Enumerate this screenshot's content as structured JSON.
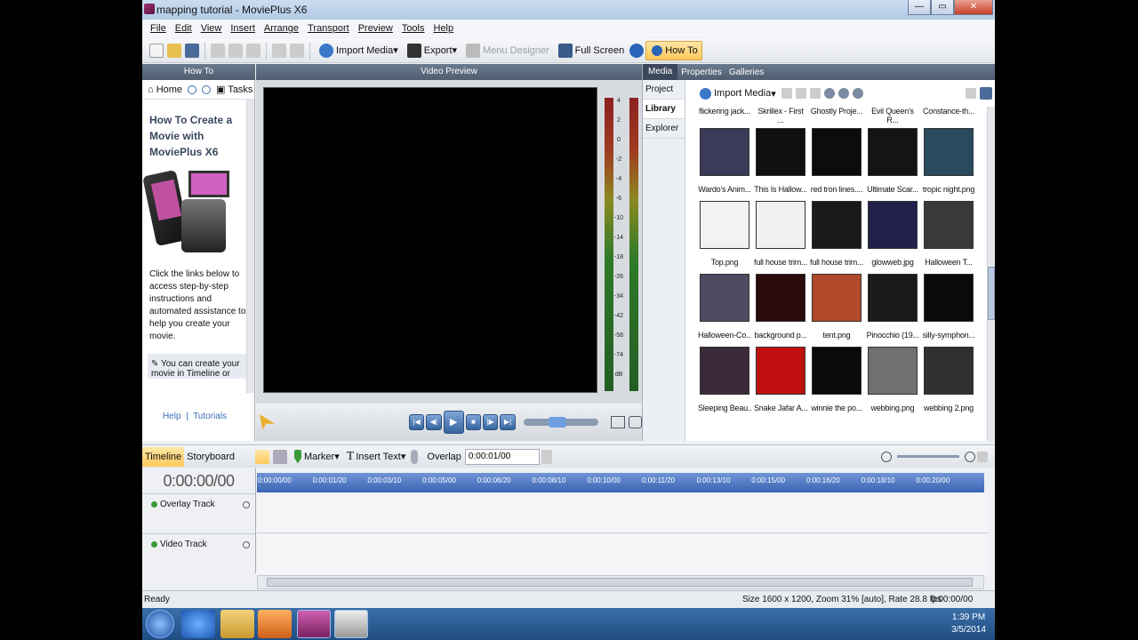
{
  "window": {
    "title": "mapping tutorial - MoviePlus X6"
  },
  "menu": [
    "File",
    "Edit",
    "View",
    "Insert",
    "Arrange",
    "Transport",
    "Preview",
    "Tools",
    "Help"
  ],
  "toolbar": {
    "import_media": "Import Media",
    "export": "Export",
    "menu_designer": "Menu Designer",
    "full_screen": "Full Screen",
    "how_to": "How To"
  },
  "howto": {
    "header": "How To",
    "home": "Home",
    "tasks": "Tasks",
    "heading": "How To Create a Movie with MoviePlus X6",
    "body": "Click the links below to access step-by-step instructions and automated assistance to help you create your movie.",
    "tip": "You can create your movie in Timeline or",
    "help": "Help",
    "tutorials": "Tutorials"
  },
  "preview": {
    "header": "Video Preview"
  },
  "meter_labels": [
    "4",
    "2",
    "0",
    "-2",
    "-4",
    "-6",
    "-10",
    "-14",
    "-18",
    "-26",
    "-34",
    "-42",
    "-58",
    "-74",
    "dB"
  ],
  "media": {
    "tabs": [
      "Media",
      "Properties",
      "Galleries"
    ],
    "side": [
      "Project",
      "Library",
      "Explorer"
    ],
    "import": "Import Media",
    "top_captions": [
      "flickering jack...",
      "Skrillex - First ...",
      "Ghostly Proje...",
      "Evil Queen's R...",
      "Constance-th..."
    ],
    "items": [
      {
        "caption": "Wardo's Anim...",
        "color": "#3a3a5a"
      },
      {
        "caption": "This Is Hallow...",
        "color": "#101010"
      },
      {
        "caption": "red tron lines....",
        "color": "#0c0c0c"
      },
      {
        "caption": "Ultimate Scar...",
        "color": "#141414"
      },
      {
        "caption": "tropic night.png",
        "color": "#2a4a60"
      },
      {
        "caption": "Top.png",
        "color": "#f2f2f2"
      },
      {
        "caption": "full house trim...",
        "color": "#f0f0f0"
      },
      {
        "caption": "full house trim...",
        "color": "#1a1a1a"
      },
      {
        "caption": "glowweb.jpg",
        "color": "#20204a"
      },
      {
        "caption": "Halloween T...",
        "color": "#3a3a3a"
      },
      {
        "caption": "Halloween-Co...",
        "color": "#504a60"
      },
      {
        "caption": "background p...",
        "color": "#2a0a0a"
      },
      {
        "caption": "tent.png",
        "color": "#b04a2a"
      },
      {
        "caption": "Pinocchio (19...",
        "color": "#1a1a1a"
      },
      {
        "caption": "silly-symphon...",
        "color": "#0a0a0a"
      },
      {
        "caption": "Sleeping Beau...",
        "color": "#3a2a3a"
      },
      {
        "caption": "Snake Jafar A...",
        "color": "#c01010"
      },
      {
        "caption": "winnie the po...",
        "color": "#0a0a0a"
      },
      {
        "caption": "webbing.png",
        "color": "#707070"
      },
      {
        "caption": "webbing 2.png",
        "color": "#303030"
      }
    ]
  },
  "timeline": {
    "tabs": [
      "Timeline",
      "Storyboard"
    ],
    "marker": "Marker",
    "insert_text": "Insert Text",
    "overlap_label": "Overlap",
    "overlap_value": "0:00:01/00",
    "time": "0:00:00/00",
    "ticks": [
      "0:00:00/00",
      "0:00:01/20",
      "0:00:03/10",
      "0:00:05/00",
      "0:00:06/20",
      "0:00:08/10",
      "0:00:10/00",
      "0:00:11/20",
      "0:00:13/10",
      "0:00:15/00",
      "0:00:16/20",
      "0:00:18/10",
      "0:00:20/00"
    ],
    "tracks": [
      "Overlay Track",
      "Video Track"
    ]
  },
  "status": {
    "left": "Ready",
    "info": "Size 1600 x 1200, Zoom 31% [auto], Rate 28.8 fps",
    "time": "0:00:00/00"
  },
  "taskbar": {
    "time": "1:39 PM",
    "date": "3/5/2014"
  }
}
